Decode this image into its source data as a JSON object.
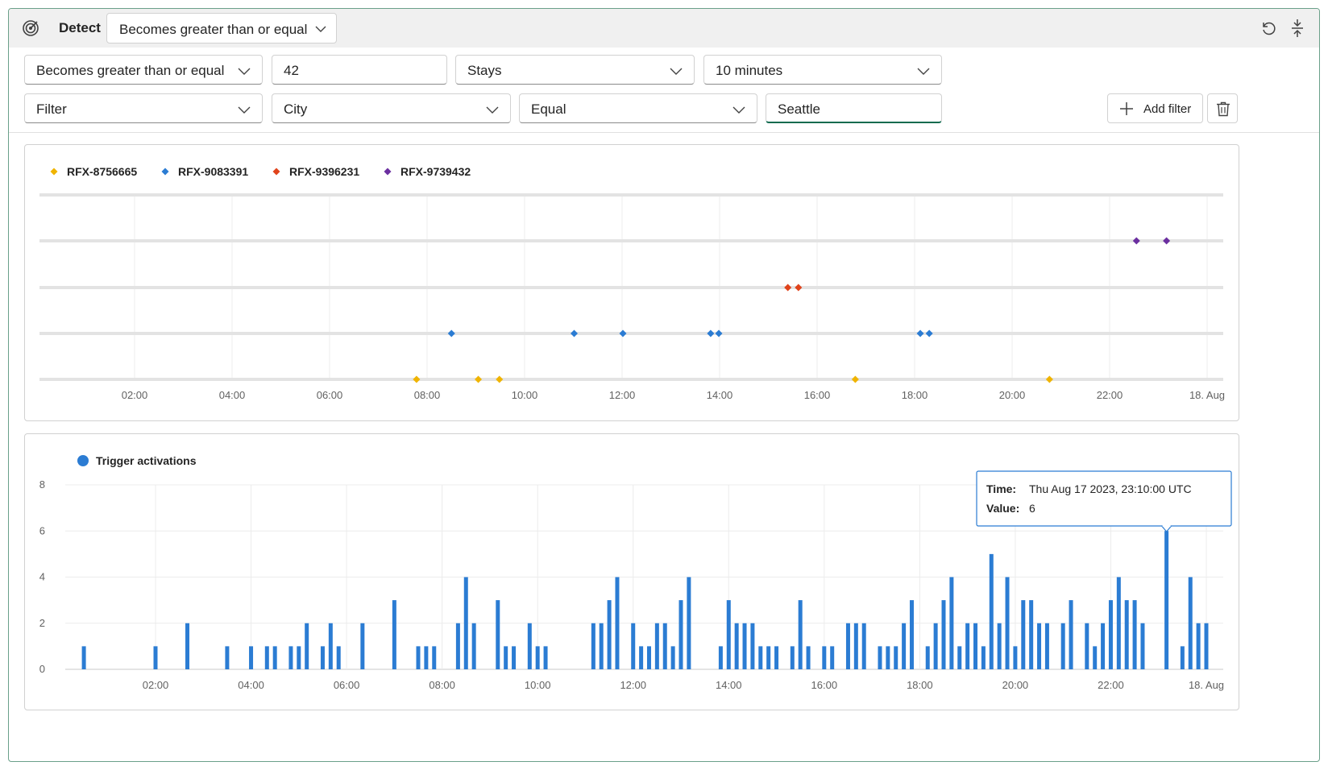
{
  "header": {
    "title": "Detect",
    "mode": "Becomes greater than or equal"
  },
  "condition": {
    "operator": "Becomes greater than or equal",
    "value": "42",
    "duration_mode": "Stays",
    "duration": "10 minutes"
  },
  "filter": {
    "type": "Filter",
    "field": "City",
    "operator": "Equal",
    "value": "Seattle",
    "add_label": "Add filter"
  },
  "icons": {
    "detect": "detect-target-icon",
    "undo": "undo-icon",
    "collapse": "collapse-icon",
    "chevron": "chevron-down-icon",
    "add": "plus-icon",
    "delete": "trash-icon"
  },
  "colors": {
    "RFX-8756665": "#f0b400",
    "RFX-9083391": "#2b7cd3",
    "RFX-9396231": "#e0431b",
    "RFX-9739432": "#6b2fa0",
    "activations": "#2b7cd3"
  },
  "chart_data": [
    {
      "type": "scatter",
      "x_ticks": [
        "02:00",
        "04:00",
        "06:00",
        "08:00",
        "10:00",
        "12:00",
        "14:00",
        "16:00",
        "18:00",
        "20:00",
        "22:00",
        "18. Aug"
      ],
      "xlim": [
        "00:07",
        "23:59"
      ],
      "grid": true,
      "legend": "top-left",
      "series": [
        {
          "name": "RFX-8756665",
          "row": 1,
          "times": [
            "07:47",
            "09:03",
            "09:29",
            "16:47",
            "20:46"
          ]
        },
        {
          "name": "RFX-9083391",
          "row": 2,
          "times": [
            "08:30",
            "11:01",
            "12:01",
            "13:49",
            "13:59",
            "18:07",
            "18:18"
          ]
        },
        {
          "name": "RFX-9396231",
          "row": 3,
          "times": [
            "15:24",
            "15:37"
          ]
        },
        {
          "name": "RFX-9739432",
          "row": 4,
          "times": [
            "22:33",
            "23:10"
          ]
        }
      ]
    },
    {
      "type": "bar",
      "ylim": [
        0,
        8
      ],
      "y_ticks": [
        0,
        2,
        4,
        6,
        8
      ],
      "x_ticks": [
        "02:00",
        "04:00",
        "06:00",
        "08:00",
        "10:00",
        "12:00",
        "14:00",
        "16:00",
        "18:00",
        "20:00",
        "22:00",
        "18. Aug"
      ],
      "xlim": [
        "00:10",
        "24:00"
      ],
      "grid": true,
      "legend": "top-left",
      "series": [
        {
          "name": "Trigger activations",
          "points": [
            [
              "00:30",
              1
            ],
            [
              "02:00",
              1
            ],
            [
              "02:40",
              2
            ],
            [
              "03:30",
              1
            ],
            [
              "04:00",
              1
            ],
            [
              "04:20",
              1
            ],
            [
              "04:30",
              1
            ],
            [
              "04:50",
              1
            ],
            [
              "05:00",
              1
            ],
            [
              "05:10",
              2
            ],
            [
              "05:30",
              1
            ],
            [
              "05:40",
              2
            ],
            [
              "05:50",
              1
            ],
            [
              "06:20",
              2
            ],
            [
              "07:00",
              3
            ],
            [
              "07:30",
              1
            ],
            [
              "07:40",
              1
            ],
            [
              "07:50",
              1
            ],
            [
              "08:20",
              2
            ],
            [
              "08:30",
              4
            ],
            [
              "08:40",
              2
            ],
            [
              "09:10",
              3
            ],
            [
              "09:20",
              1
            ],
            [
              "09:30",
              1
            ],
            [
              "09:50",
              2
            ],
            [
              "10:00",
              1
            ],
            [
              "10:10",
              1
            ],
            [
              "11:10",
              2
            ],
            [
              "11:20",
              2
            ],
            [
              "11:30",
              3
            ],
            [
              "11:40",
              4
            ],
            [
              "12:00",
              2
            ],
            [
              "12:10",
              1
            ],
            [
              "12:20",
              1
            ],
            [
              "12:30",
              2
            ],
            [
              "12:40",
              2
            ],
            [
              "12:50",
              1
            ],
            [
              "13:00",
              3
            ],
            [
              "13:10",
              4
            ],
            [
              "13:50",
              1
            ],
            [
              "14:00",
              3
            ],
            [
              "14:10",
              2
            ],
            [
              "14:20",
              2
            ],
            [
              "14:30",
              2
            ],
            [
              "14:40",
              1
            ],
            [
              "14:50",
              1
            ],
            [
              "15:00",
              1
            ],
            [
              "15:20",
              1
            ],
            [
              "15:30",
              3
            ],
            [
              "15:40",
              1
            ],
            [
              "16:00",
              1
            ],
            [
              "16:10",
              1
            ],
            [
              "16:30",
              2
            ],
            [
              "16:40",
              2
            ],
            [
              "16:50",
              2
            ],
            [
              "17:10",
              1
            ],
            [
              "17:20",
              1
            ],
            [
              "17:30",
              1
            ],
            [
              "17:40",
              2
            ],
            [
              "17:50",
              3
            ],
            [
              "18:10",
              1
            ],
            [
              "18:20",
              2
            ],
            [
              "18:30",
              3
            ],
            [
              "18:40",
              4
            ],
            [
              "18:50",
              1
            ],
            [
              "19:00",
              2
            ],
            [
              "19:10",
              2
            ],
            [
              "19:20",
              1
            ],
            [
              "19:30",
              5
            ],
            [
              "19:40",
              2
            ],
            [
              "19:50",
              4
            ],
            [
              "20:00",
              1
            ],
            [
              "20:10",
              3
            ],
            [
              "20:20",
              3
            ],
            [
              "20:30",
              2
            ],
            [
              "20:40",
              2
            ],
            [
              "21:00",
              2
            ],
            [
              "21:10",
              3
            ],
            [
              "21:30",
              2
            ],
            [
              "21:40",
              1
            ],
            [
              "21:50",
              2
            ],
            [
              "22:00",
              3
            ],
            [
              "22:10",
              4
            ],
            [
              "22:20",
              3
            ],
            [
              "22:30",
              3
            ],
            [
              "22:40",
              2
            ],
            [
              "23:10",
              6
            ],
            [
              "23:30",
              1
            ],
            [
              "23:40",
              4
            ],
            [
              "23:50",
              2
            ],
            [
              "24:00",
              2
            ]
          ]
        }
      ],
      "tooltip": {
        "time_label": "Time:",
        "time_value": "Thu Aug 17 2023, 23:10:00 UTC",
        "value_label": "Value:",
        "value": "6"
      }
    }
  ]
}
